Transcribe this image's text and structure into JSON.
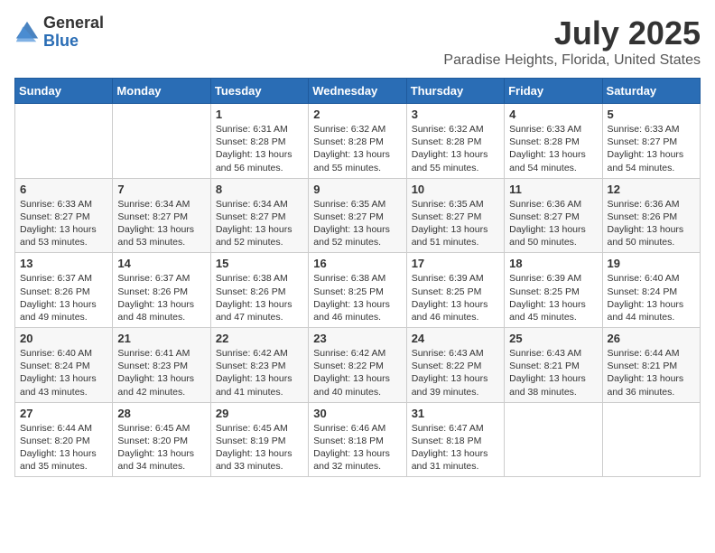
{
  "header": {
    "logo_general": "General",
    "logo_blue": "Blue",
    "month_title": "July 2025",
    "location": "Paradise Heights, Florida, United States"
  },
  "days_of_week": [
    "Sunday",
    "Monday",
    "Tuesday",
    "Wednesday",
    "Thursday",
    "Friday",
    "Saturday"
  ],
  "weeks": [
    [
      {
        "day": "",
        "sunrise": "",
        "sunset": "",
        "daylight": ""
      },
      {
        "day": "",
        "sunrise": "",
        "sunset": "",
        "daylight": ""
      },
      {
        "day": "1",
        "sunrise": "Sunrise: 6:31 AM",
        "sunset": "Sunset: 8:28 PM",
        "daylight": "Daylight: 13 hours and 56 minutes."
      },
      {
        "day": "2",
        "sunrise": "Sunrise: 6:32 AM",
        "sunset": "Sunset: 8:28 PM",
        "daylight": "Daylight: 13 hours and 55 minutes."
      },
      {
        "day": "3",
        "sunrise": "Sunrise: 6:32 AM",
        "sunset": "Sunset: 8:28 PM",
        "daylight": "Daylight: 13 hours and 55 minutes."
      },
      {
        "day": "4",
        "sunrise": "Sunrise: 6:33 AM",
        "sunset": "Sunset: 8:28 PM",
        "daylight": "Daylight: 13 hours and 54 minutes."
      },
      {
        "day": "5",
        "sunrise": "Sunrise: 6:33 AM",
        "sunset": "Sunset: 8:27 PM",
        "daylight": "Daylight: 13 hours and 54 minutes."
      }
    ],
    [
      {
        "day": "6",
        "sunrise": "Sunrise: 6:33 AM",
        "sunset": "Sunset: 8:27 PM",
        "daylight": "Daylight: 13 hours and 53 minutes."
      },
      {
        "day": "7",
        "sunrise": "Sunrise: 6:34 AM",
        "sunset": "Sunset: 8:27 PM",
        "daylight": "Daylight: 13 hours and 53 minutes."
      },
      {
        "day": "8",
        "sunrise": "Sunrise: 6:34 AM",
        "sunset": "Sunset: 8:27 PM",
        "daylight": "Daylight: 13 hours and 52 minutes."
      },
      {
        "day": "9",
        "sunrise": "Sunrise: 6:35 AM",
        "sunset": "Sunset: 8:27 PM",
        "daylight": "Daylight: 13 hours and 52 minutes."
      },
      {
        "day": "10",
        "sunrise": "Sunrise: 6:35 AM",
        "sunset": "Sunset: 8:27 PM",
        "daylight": "Daylight: 13 hours and 51 minutes."
      },
      {
        "day": "11",
        "sunrise": "Sunrise: 6:36 AM",
        "sunset": "Sunset: 8:27 PM",
        "daylight": "Daylight: 13 hours and 50 minutes."
      },
      {
        "day": "12",
        "sunrise": "Sunrise: 6:36 AM",
        "sunset": "Sunset: 8:26 PM",
        "daylight": "Daylight: 13 hours and 50 minutes."
      }
    ],
    [
      {
        "day": "13",
        "sunrise": "Sunrise: 6:37 AM",
        "sunset": "Sunset: 8:26 PM",
        "daylight": "Daylight: 13 hours and 49 minutes."
      },
      {
        "day": "14",
        "sunrise": "Sunrise: 6:37 AM",
        "sunset": "Sunset: 8:26 PM",
        "daylight": "Daylight: 13 hours and 48 minutes."
      },
      {
        "day": "15",
        "sunrise": "Sunrise: 6:38 AM",
        "sunset": "Sunset: 8:26 PM",
        "daylight": "Daylight: 13 hours and 47 minutes."
      },
      {
        "day": "16",
        "sunrise": "Sunrise: 6:38 AM",
        "sunset": "Sunset: 8:25 PM",
        "daylight": "Daylight: 13 hours and 46 minutes."
      },
      {
        "day": "17",
        "sunrise": "Sunrise: 6:39 AM",
        "sunset": "Sunset: 8:25 PM",
        "daylight": "Daylight: 13 hours and 46 minutes."
      },
      {
        "day": "18",
        "sunrise": "Sunrise: 6:39 AM",
        "sunset": "Sunset: 8:25 PM",
        "daylight": "Daylight: 13 hours and 45 minutes."
      },
      {
        "day": "19",
        "sunrise": "Sunrise: 6:40 AM",
        "sunset": "Sunset: 8:24 PM",
        "daylight": "Daylight: 13 hours and 44 minutes."
      }
    ],
    [
      {
        "day": "20",
        "sunrise": "Sunrise: 6:40 AM",
        "sunset": "Sunset: 8:24 PM",
        "daylight": "Daylight: 13 hours and 43 minutes."
      },
      {
        "day": "21",
        "sunrise": "Sunrise: 6:41 AM",
        "sunset": "Sunset: 8:23 PM",
        "daylight": "Daylight: 13 hours and 42 minutes."
      },
      {
        "day": "22",
        "sunrise": "Sunrise: 6:42 AM",
        "sunset": "Sunset: 8:23 PM",
        "daylight": "Daylight: 13 hours and 41 minutes."
      },
      {
        "day": "23",
        "sunrise": "Sunrise: 6:42 AM",
        "sunset": "Sunset: 8:22 PM",
        "daylight": "Daylight: 13 hours and 40 minutes."
      },
      {
        "day": "24",
        "sunrise": "Sunrise: 6:43 AM",
        "sunset": "Sunset: 8:22 PM",
        "daylight": "Daylight: 13 hours and 39 minutes."
      },
      {
        "day": "25",
        "sunrise": "Sunrise: 6:43 AM",
        "sunset": "Sunset: 8:21 PM",
        "daylight": "Daylight: 13 hours and 38 minutes."
      },
      {
        "day": "26",
        "sunrise": "Sunrise: 6:44 AM",
        "sunset": "Sunset: 8:21 PM",
        "daylight": "Daylight: 13 hours and 36 minutes."
      }
    ],
    [
      {
        "day": "27",
        "sunrise": "Sunrise: 6:44 AM",
        "sunset": "Sunset: 8:20 PM",
        "daylight": "Daylight: 13 hours and 35 minutes."
      },
      {
        "day": "28",
        "sunrise": "Sunrise: 6:45 AM",
        "sunset": "Sunset: 8:20 PM",
        "daylight": "Daylight: 13 hours and 34 minutes."
      },
      {
        "day": "29",
        "sunrise": "Sunrise: 6:45 AM",
        "sunset": "Sunset: 8:19 PM",
        "daylight": "Daylight: 13 hours and 33 minutes."
      },
      {
        "day": "30",
        "sunrise": "Sunrise: 6:46 AM",
        "sunset": "Sunset: 8:18 PM",
        "daylight": "Daylight: 13 hours and 32 minutes."
      },
      {
        "day": "31",
        "sunrise": "Sunrise: 6:47 AM",
        "sunset": "Sunset: 8:18 PM",
        "daylight": "Daylight: 13 hours and 31 minutes."
      },
      {
        "day": "",
        "sunrise": "",
        "sunset": "",
        "daylight": ""
      },
      {
        "day": "",
        "sunrise": "",
        "sunset": "",
        "daylight": ""
      }
    ]
  ]
}
